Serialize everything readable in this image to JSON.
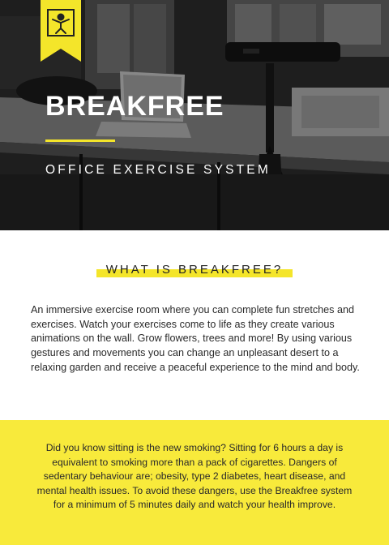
{
  "hero": {
    "title": "BREAKFREE",
    "subtitle": "OFFICE EXERCISE SYSTEM"
  },
  "logo": {
    "icon": "person-exercise-icon",
    "color": "#f4e52a"
  },
  "intro_section": {
    "heading": "WHAT IS BREAKFREE?",
    "body": "An immersive exercise room where you can complete fun stretches and exercises. Watch your exercises come to life as they create various animations on the wall. Grow flowers, trees and more! By using various gestures and movements you can change an unpleasant desert to a relaxing garden and receive a peaceful experience to the mind and body."
  },
  "facts_section": {
    "body": "Did you know sitting is the new smoking? Sitting for 6 hours a day is equivalent to smoking more than a pack of cigarettes. Dangers of sedentary behaviour are; obesity, type 2 diabetes, heart disease, and mental health issues. To avoid these dangers, use the Breakfree system for a minimum of 5 minutes daily and watch your health improve."
  },
  "colors": {
    "accent": "#f4e52a",
    "band": "#f8ea3b",
    "text": "#2a2a2a"
  }
}
